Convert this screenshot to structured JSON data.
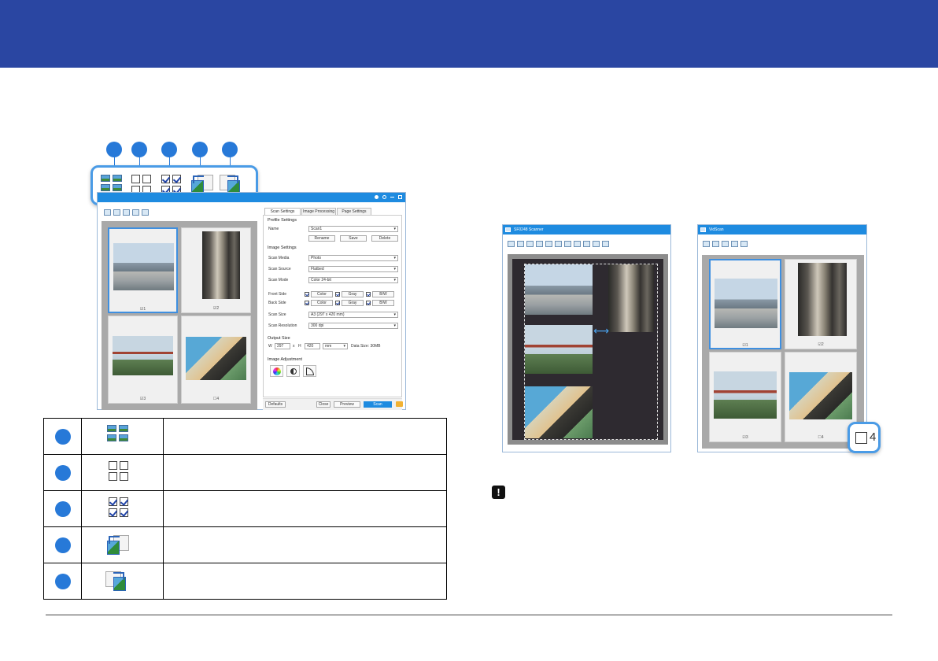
{
  "app": {
    "profile_settings_tab": "Scan Settings",
    "image_processing_tab": "Image Processing",
    "page_settings_tab": "Page Settings"
  },
  "scan_settings": {
    "profile_settings_title": "Profile Settings",
    "name_label": "Name",
    "name_value": "Scan1",
    "rename_button": "Rename",
    "save_button": "Save",
    "delete_button": "Delete",
    "image_settings_title": "Image Settings",
    "scan_media_label": "Scan Media",
    "scan_media_value": "Photo",
    "scan_source_label": "Scan Source",
    "scan_source_value": "Flatbed",
    "scan_mode_label": "Scan Mode",
    "scan_mode_value": "Color 24-bit",
    "front_side_label": "Front Side",
    "back_side_label": "Back Side",
    "color_label": "Color",
    "gray_label": "Gray",
    "bw_label": "B/W",
    "scan_size_label": "Scan Size",
    "scan_size_value": "A3 (297 x 420 mm)",
    "scan_resolution_label": "Scan Resolution",
    "scan_resolution_value": "300 dpi",
    "output_size_title": "Output Size",
    "w_label": "W",
    "w_value": "297",
    "x_label": "x",
    "h_label": "H",
    "h_value": "420",
    "unit_value": "mm",
    "data_size": "Data Size: 30MB",
    "image_adjustment_title": "Image Adjustment"
  },
  "footer_buttons": {
    "defaults": "Defaults",
    "close": "Close",
    "preview": "Preview",
    "scan": "Scan"
  },
  "thumb_labels": [
    "1",
    "2",
    "3",
    "4"
  ],
  "preview_window_title": "SF0248 Scanner",
  "thumb_window_title": "VidScan",
  "zoom_label": "4",
  "colors": {
    "banner": "#2a46a2",
    "accent": "#2779d8",
    "titlebar": "#1e8be0"
  }
}
